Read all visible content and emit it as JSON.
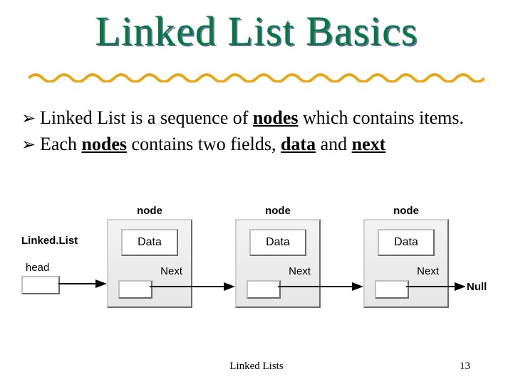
{
  "title": "Linked List Basics",
  "bullets": [
    {
      "lead": "Linked List is a sequence of ",
      "u1": "nodes",
      "mid": " which contains items.",
      "u2": "",
      "mid2": "",
      "u3": "",
      "tail": ""
    },
    {
      "lead": " Each ",
      "u1": "nodes",
      "mid": " contains two fields, ",
      "u2": "data",
      "mid2": " and ",
      "u3": "next",
      "tail": ""
    }
  ],
  "diagram": {
    "listLabel": "Linked.List",
    "headLabel": "head",
    "nodeCaption": "node",
    "dataLabel": "Data",
    "nextLabel": "Next",
    "nullLabel": "Null",
    "nodeCount": 3
  },
  "footer": {
    "center": "Linked Lists",
    "page": "13"
  },
  "bulletGlyph": "➢"
}
